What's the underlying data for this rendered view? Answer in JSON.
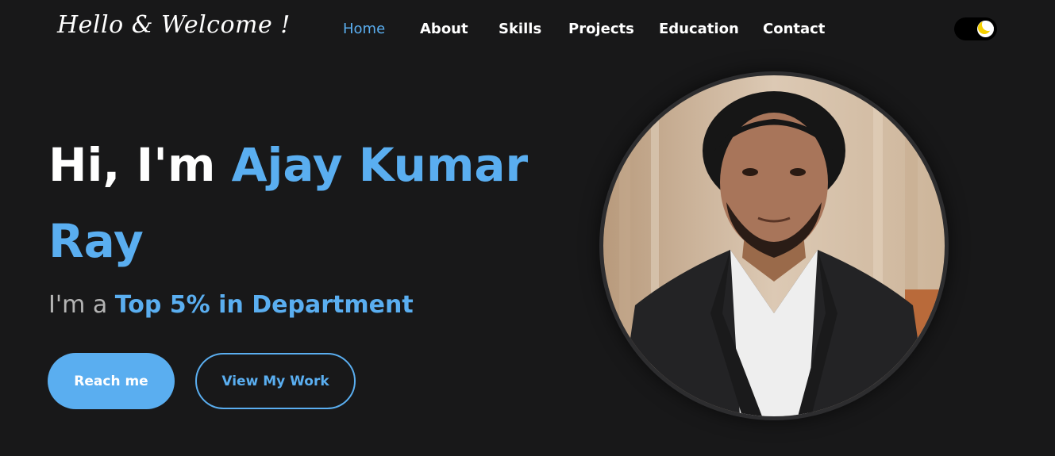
{
  "navbar": {
    "logo": "Hello & Welcome !",
    "links": [
      {
        "label": "Home",
        "active": true
      },
      {
        "label": "About"
      },
      {
        "label": "Skills"
      },
      {
        "label": "Projects"
      },
      {
        "label": "Education"
      },
      {
        "label": "Contact"
      }
    ],
    "theme_toggle": {
      "icon": "moon-icon",
      "state": "dark"
    }
  },
  "hero": {
    "greeting": "Hi, I'm",
    "name": "Ajay Kumar Ray",
    "subtitle_prefix": "I'm a",
    "role": "Top 5% in Department",
    "primary_button": "Reach me",
    "secondary_button": "View My Work"
  },
  "profile": {
    "image": "profile-photo"
  },
  "colors": {
    "background": "#181819",
    "accent": "#5aaef0",
    "text": "#ffffff",
    "muted": "#b4b4b4"
  }
}
